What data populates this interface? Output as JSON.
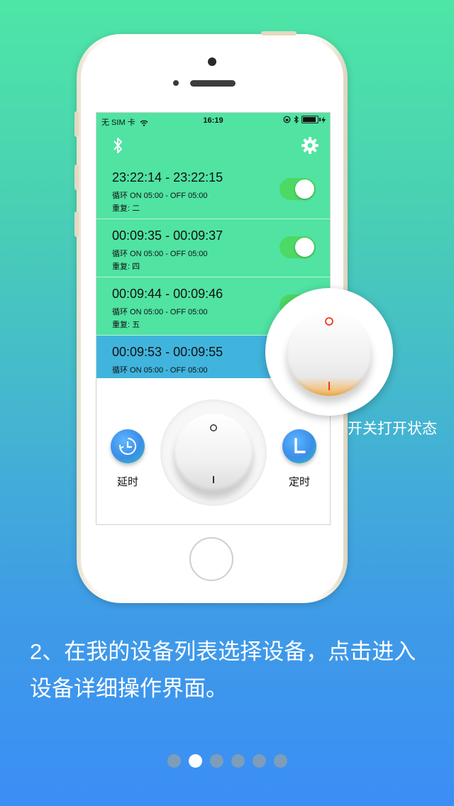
{
  "colors": {
    "accent_green": "#50e3a2",
    "selected_row_blue": "#40b4dd",
    "toggle_on": "#4cd964"
  },
  "status_bar": {
    "carrier": "无 SIM 卡",
    "time": "16:19",
    "wifi_icon": "wifi-icon",
    "battery_icon": "battery-icon"
  },
  "navbar": {
    "left_icon": "bluetooth-icon",
    "right_icon": "gear-icon"
  },
  "schedules": [
    {
      "range": "23:22:14 - 23:22:15",
      "cycle": "循环 ON 05:00 - OFF 05:00",
      "repeat": "重复: 二",
      "enabled": true
    },
    {
      "range": "00:09:35 - 00:09:37",
      "cycle": "循环 ON 05:00 - OFF 05:00",
      "repeat": "重复: 四",
      "enabled": true
    },
    {
      "range": "00:09:44 - 00:09:46",
      "cycle": "循环 ON 05:00 - OFF 05:00",
      "repeat": "重复: 五",
      "enabled": true
    },
    {
      "range": "00:09:53 - 00:09:55",
      "cycle": "循环 ON 05:00 - OFF 05:00",
      "repeat": "",
      "enabled": false
    }
  ],
  "controls": {
    "delay_label": "延时",
    "timer_label": "定时"
  },
  "callout": {
    "label": "开关打开状态"
  },
  "caption": {
    "line1": "2、在我的设备列表选择设备，点击进入",
    "line2": "设备详细操作界面。"
  },
  "pagination": {
    "total": 6,
    "active_index": 1
  }
}
